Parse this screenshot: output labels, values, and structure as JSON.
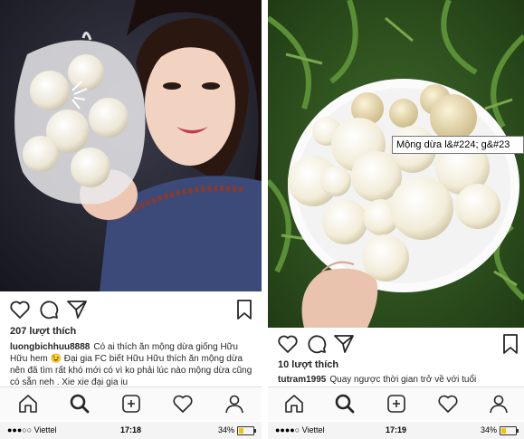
{
  "left_post": {
    "likes": "207 lượt thích",
    "username": "luongbichhuu8888",
    "caption": "Có ai thích ăn mộng dừa giống Hữu Hữu hem 😉 Đại gia FC biết Hữu Hữu thích ăn mộng dừa nên đã tìm rất khó mới có vì ko phải lúc nào mộng dừa cũng có sẵn neh . Xie xie đại gia iu",
    "photo_icon": "woman-holding-bag-of-coconut-sprouts"
  },
  "right_post": {
    "likes": "10 lượt thích",
    "username": "tutram1995",
    "caption": "Quay ngược thời gian trở về với tuổi",
    "photo_icon": "plate-of-coconut-sprouts",
    "tooltip": "Mộng dừa l&#224; g&#23"
  },
  "left_status": {
    "carrier": "●●●○○ Viettel",
    "time": "17:18",
    "battery": "34%",
    "battery_level": 0.34
  },
  "right_status": {
    "carrier": "●●●●○ Viettel",
    "time": "17:19",
    "battery": "34%",
    "battery_level": 0.34
  },
  "icons": {
    "like": "heart-outline-icon",
    "comment": "comment-bubble-icon",
    "share": "paper-plane-icon",
    "save": "bookmark-icon",
    "tabs": [
      "home-icon",
      "search-icon",
      "add-post-icon",
      "activity-heart-icon",
      "profile-icon"
    ]
  },
  "colors": {
    "text": "#262626",
    "tabbar_bg": "#fafafa",
    "border": "#dbdbdb"
  }
}
